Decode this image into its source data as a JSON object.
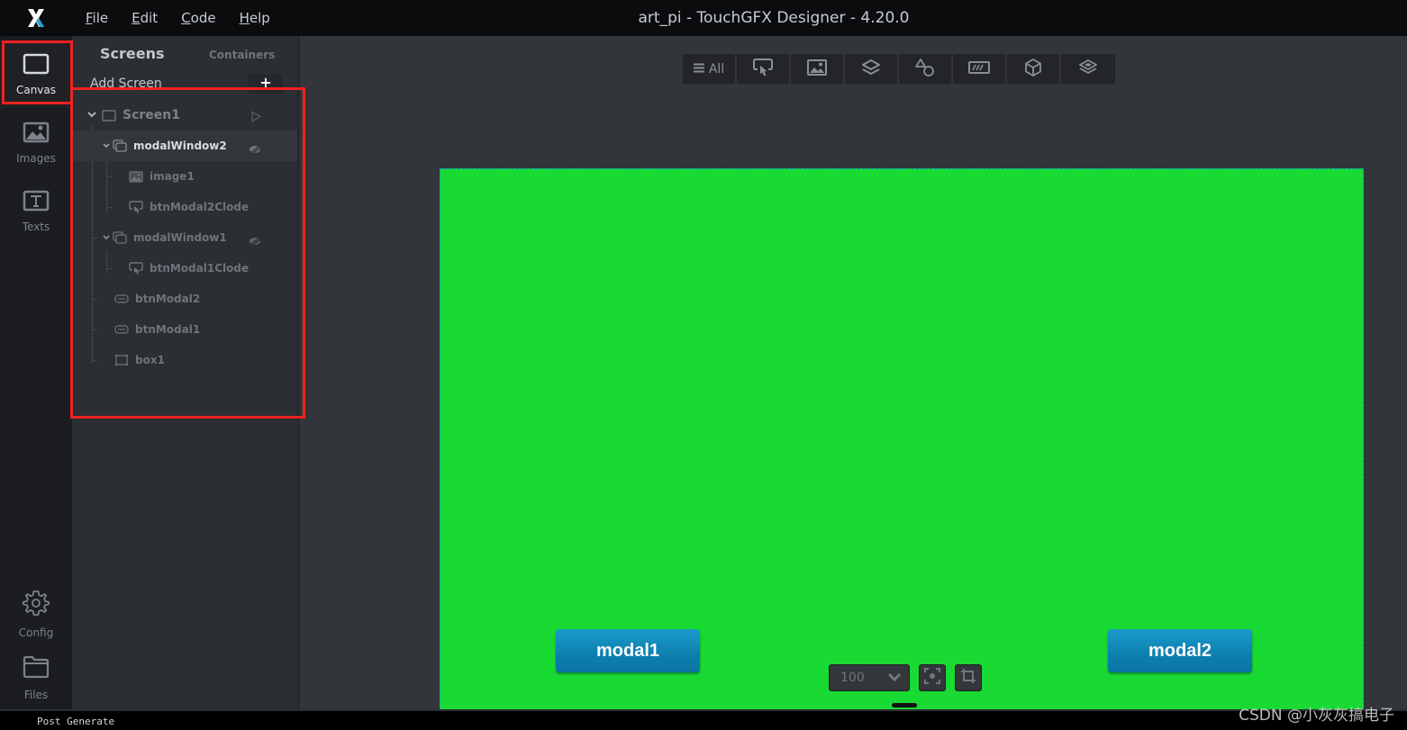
{
  "app": {
    "title": "art_pi - TouchGFX Designer - 4.20.0",
    "logo_icon": "touchgfx-x-logo"
  },
  "menu": [
    {
      "label": "File",
      "mnemonic": "F",
      "rest": "ile"
    },
    {
      "label": "Edit",
      "mnemonic": "E",
      "rest": "dit"
    },
    {
      "label": "Code",
      "mnemonic": "C",
      "rest": "ode"
    },
    {
      "label": "Help",
      "mnemonic": "H",
      "rest": "elp"
    }
  ],
  "leftnav": {
    "items": [
      {
        "label": "Canvas",
        "icon": "canvas-icon",
        "active": true
      },
      {
        "label": "Images",
        "icon": "image-icon"
      },
      {
        "label": "Texts",
        "icon": "text-icon"
      },
      {
        "label": "Config",
        "icon": "gear-icon"
      },
      {
        "label": "Files",
        "icon": "folder-icon"
      }
    ]
  },
  "panel": {
    "tabs": [
      {
        "label": "Screens",
        "active": true
      },
      {
        "label": "Containers"
      }
    ],
    "add_screen_label": "Add Screen",
    "add_button": "+",
    "tree": [
      {
        "label": "Screen1",
        "type": "screen",
        "depth": 0
      },
      {
        "label": "modalWindow2",
        "type": "modal-window",
        "depth": 1,
        "selected": true
      },
      {
        "label": "image1",
        "type": "image",
        "depth": 2
      },
      {
        "label": "btnModal2Clode",
        "type": "flex-button",
        "depth": 2
      },
      {
        "label": "modalWindow1",
        "type": "modal-window",
        "depth": 1
      },
      {
        "label": "btnModal1Clode",
        "type": "flex-button",
        "depth": 2
      },
      {
        "label": "btnModal2",
        "type": "text-button",
        "depth": 1
      },
      {
        "label": "btnModal1",
        "type": "text-button",
        "depth": 1
      },
      {
        "label": "box1",
        "type": "box",
        "depth": 1
      }
    ]
  },
  "toolbar": {
    "filter_all_label": "All",
    "filters": [
      "all",
      "buttons",
      "images",
      "containers",
      "shapes",
      "progress",
      "3d",
      "layers"
    ]
  },
  "canvas": {
    "background_color": "#19d933",
    "buttons": [
      {
        "label": "modal1"
      },
      {
        "label": "modal2"
      }
    ],
    "zoom_value": "100"
  },
  "console": {
    "text": "Post Generate"
  },
  "watermark": "CSDN @小灰灰搞电子"
}
